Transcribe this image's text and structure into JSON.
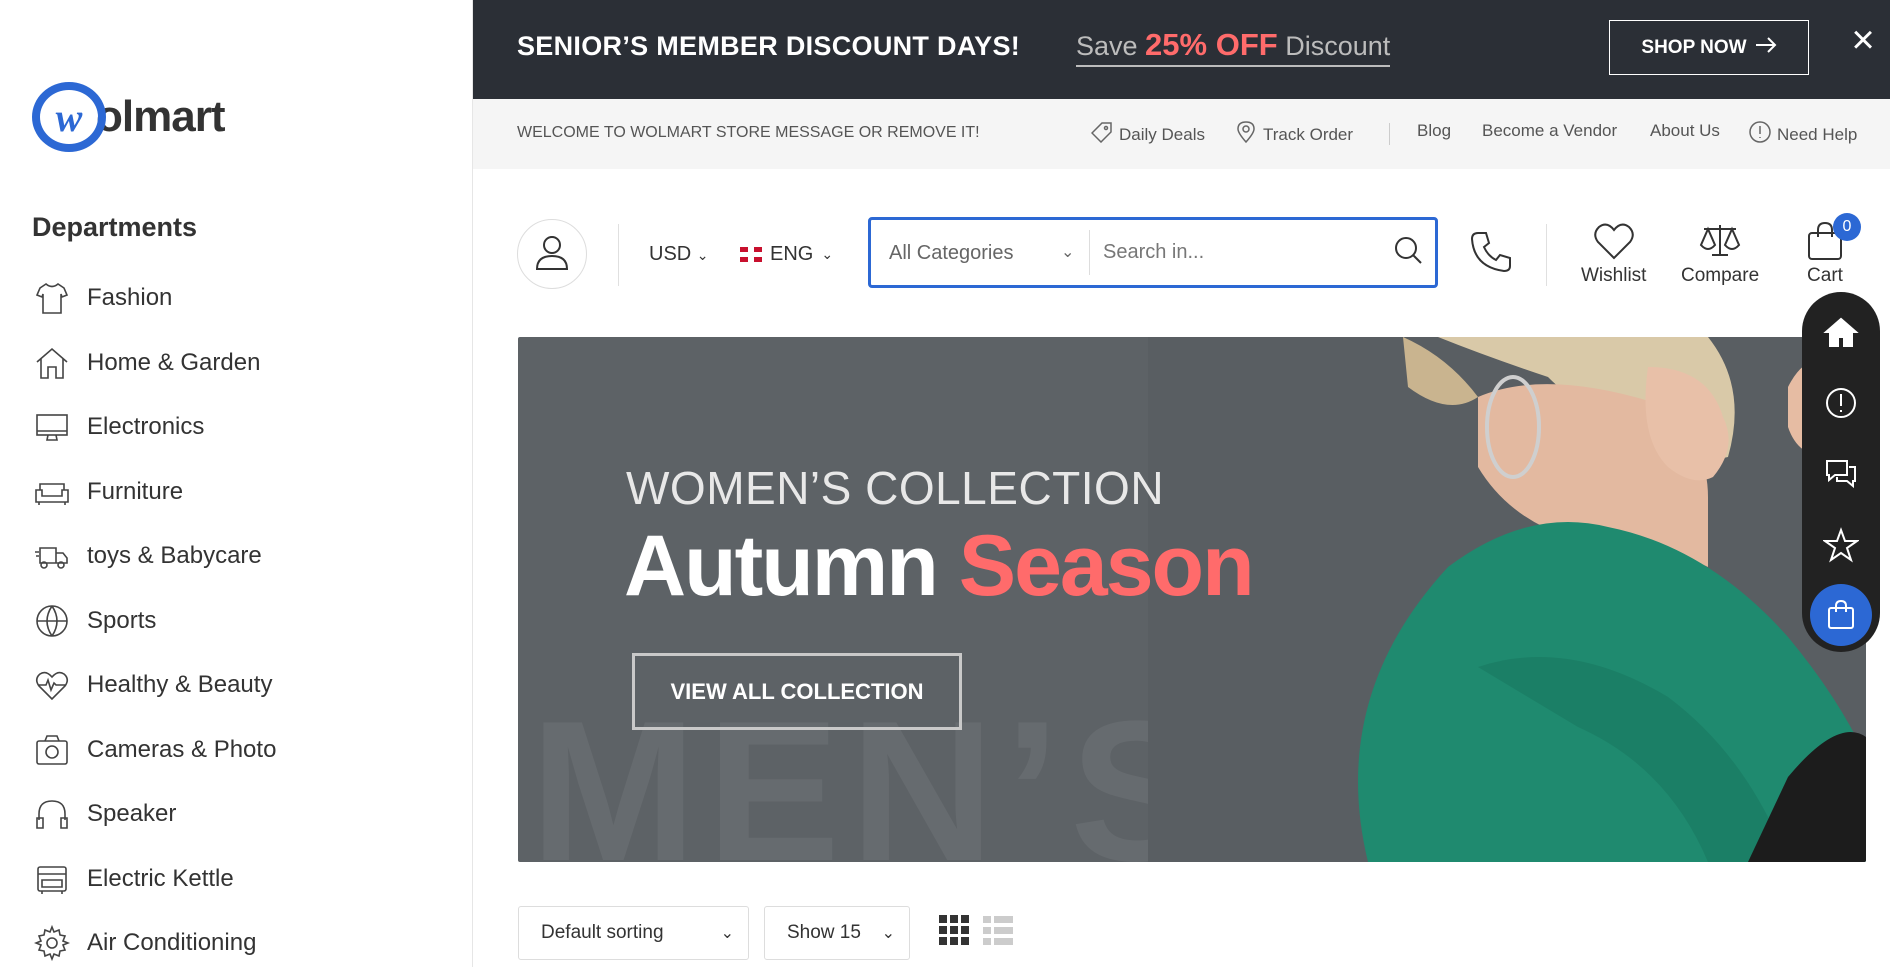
{
  "sidebar": {
    "logo_mark": "w",
    "logo_word": "olmart",
    "departments_title": "Departments",
    "items": [
      {
        "label": "Fashion",
        "icon": "shirt-icon"
      },
      {
        "label": "Home & Garden",
        "icon": "home-icon"
      },
      {
        "label": "Electronics",
        "icon": "monitor-icon"
      },
      {
        "label": "Furniture",
        "icon": "sofa-icon"
      },
      {
        "label": "toys & Babycare",
        "icon": "truck-icon"
      },
      {
        "label": "Sports",
        "icon": "ball-icon"
      },
      {
        "label": "Healthy & Beauty",
        "icon": "heartbeat-icon"
      },
      {
        "label": "Cameras & Photo",
        "icon": "camera-icon"
      },
      {
        "label": "Speaker",
        "icon": "headphones-icon"
      },
      {
        "label": "Electric Kettle",
        "icon": "kettle-icon"
      },
      {
        "label": "Air Conditioning",
        "icon": "gear-icon"
      }
    ]
  },
  "promo": {
    "title": "SENIOR’S MEMBER DISCOUNT DAYS!",
    "save_prefix": "Save ",
    "save_highlight": "25% OFF",
    "save_suffix": " Discount",
    "shop_now": "SHOP NOW",
    "close": "×"
  },
  "topbar": {
    "welcome": "WELCOME TO WOLMART STORE MESSAGE OR REMOVE IT!",
    "daily_deals": "Daily Deals",
    "track_order": "Track Order",
    "blog": "Blog",
    "become_vendor": "Become a Vendor",
    "about_us": "About Us",
    "need_help": "Need Help"
  },
  "header": {
    "currency": "USD",
    "language": "ENG",
    "category_select": "All Categories",
    "search_placeholder": "Search in...",
    "wishlist": "Wishlist",
    "compare": "Compare",
    "cart": "Cart",
    "cart_count": "0"
  },
  "hero": {
    "subtitle": "WOMEN’S COLLECTION",
    "title_main": "Autumn ",
    "title_accent": "Season",
    "button": "VIEW ALL COLLECTION",
    "watermark": "MEN’S",
    "accent_color": "#ff6b6b"
  },
  "toolbar": {
    "sorting": "Default sorting",
    "show": "Show 15"
  },
  "colors": {
    "brand": "#2c68d4",
    "promo_bg": "#2b2f36",
    "hero_bg": "#5d6266"
  }
}
